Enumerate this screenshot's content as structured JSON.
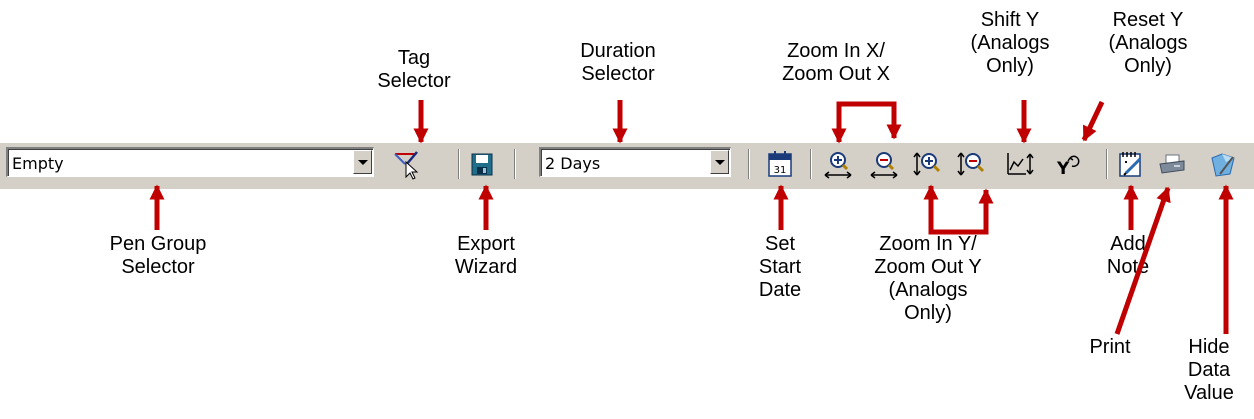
{
  "toolbar": {
    "pen_group_value": "Empty",
    "duration_value": "2 Days",
    "calendar_day": "31"
  },
  "callouts": {
    "tag_selector": "Tag\nSelector",
    "duration_selector": "Duration\nSelector",
    "zoom_x": "Zoom In X/\nZoom Out X",
    "shift_y": "Shift Y\n(Analogs\nOnly)",
    "reset_y": "Reset Y\n(Analogs\nOnly)",
    "pen_group_selector": "Pen Group\nSelector",
    "export_wizard": "Export\nWizard",
    "set_start_date": "Set\nStart\nDate",
    "zoom_y": "Zoom In Y/\nZoom Out Y\n(Analogs\nOnly)",
    "add_note": "Add\nNote",
    "print": "Print",
    "hide_data_value": "Hide\nData\nValue"
  },
  "colors": {
    "toolbar_bg": "#d4d0c8",
    "arrow_red": "#c00000"
  },
  "icons": [
    "tag-selector-icon",
    "export-save-icon",
    "calendar-icon",
    "zoom-in-x-icon",
    "zoom-out-x-icon",
    "zoom-in-y-icon",
    "zoom-out-y-icon",
    "shift-y-icon",
    "reset-y-icon",
    "add-note-icon",
    "print-icon",
    "hide-data-value-icon"
  ]
}
